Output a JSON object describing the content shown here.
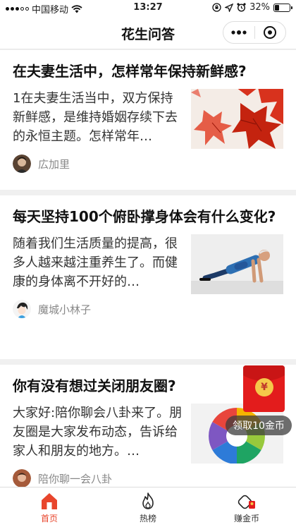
{
  "status_bar": {
    "carrier": "中国移动",
    "time": "13:27",
    "battery": "32%",
    "battery_level": 0.32
  },
  "nav": {
    "title": "花生问答",
    "more_icon": "more-dots-icon",
    "close_icon": "target-circle-icon"
  },
  "articles": [
    {
      "title": "在夫妻生活中，怎样常年保持新鲜感?",
      "summary": "1在夫妻生活当中，双方保持新鲜感，是维持婚姻存续下去的永恒主题。怎样常年…",
      "author": "広加里",
      "thumbnail": "red-maple-leaves"
    },
    {
      "title": "每天坚持100个俯卧撑身体会有什么变化?",
      "summary": "随着我们生活质量的提高，很多人越来越注重养生了。而健康的身体离不开好的…",
      "author": "魔城小林子",
      "thumbnail": "man-doing-pushups"
    },
    {
      "title": "你有没有想过关闭朋友圈?",
      "summary": "大家好:陪你聊会八卦来了。朋友圈是大家发布动态，告诉给家人和朋友的地方。…",
      "author": "陪你聊一会八卦",
      "thumbnail": "moments-aperture-logo"
    }
  ],
  "reward": {
    "symbol": "¥",
    "label": "领取10金币"
  },
  "tabs": [
    {
      "label": "首页",
      "icon": "home-icon",
      "active": true
    },
    {
      "label": "热榜",
      "icon": "flame-icon",
      "active": false
    },
    {
      "label": "赚金币",
      "icon": "coin-wallet-icon",
      "active": false
    }
  ],
  "colors": {
    "accent": "#e8452c",
    "redpacket": "#e31c1c",
    "coin": "#f5c84a"
  }
}
